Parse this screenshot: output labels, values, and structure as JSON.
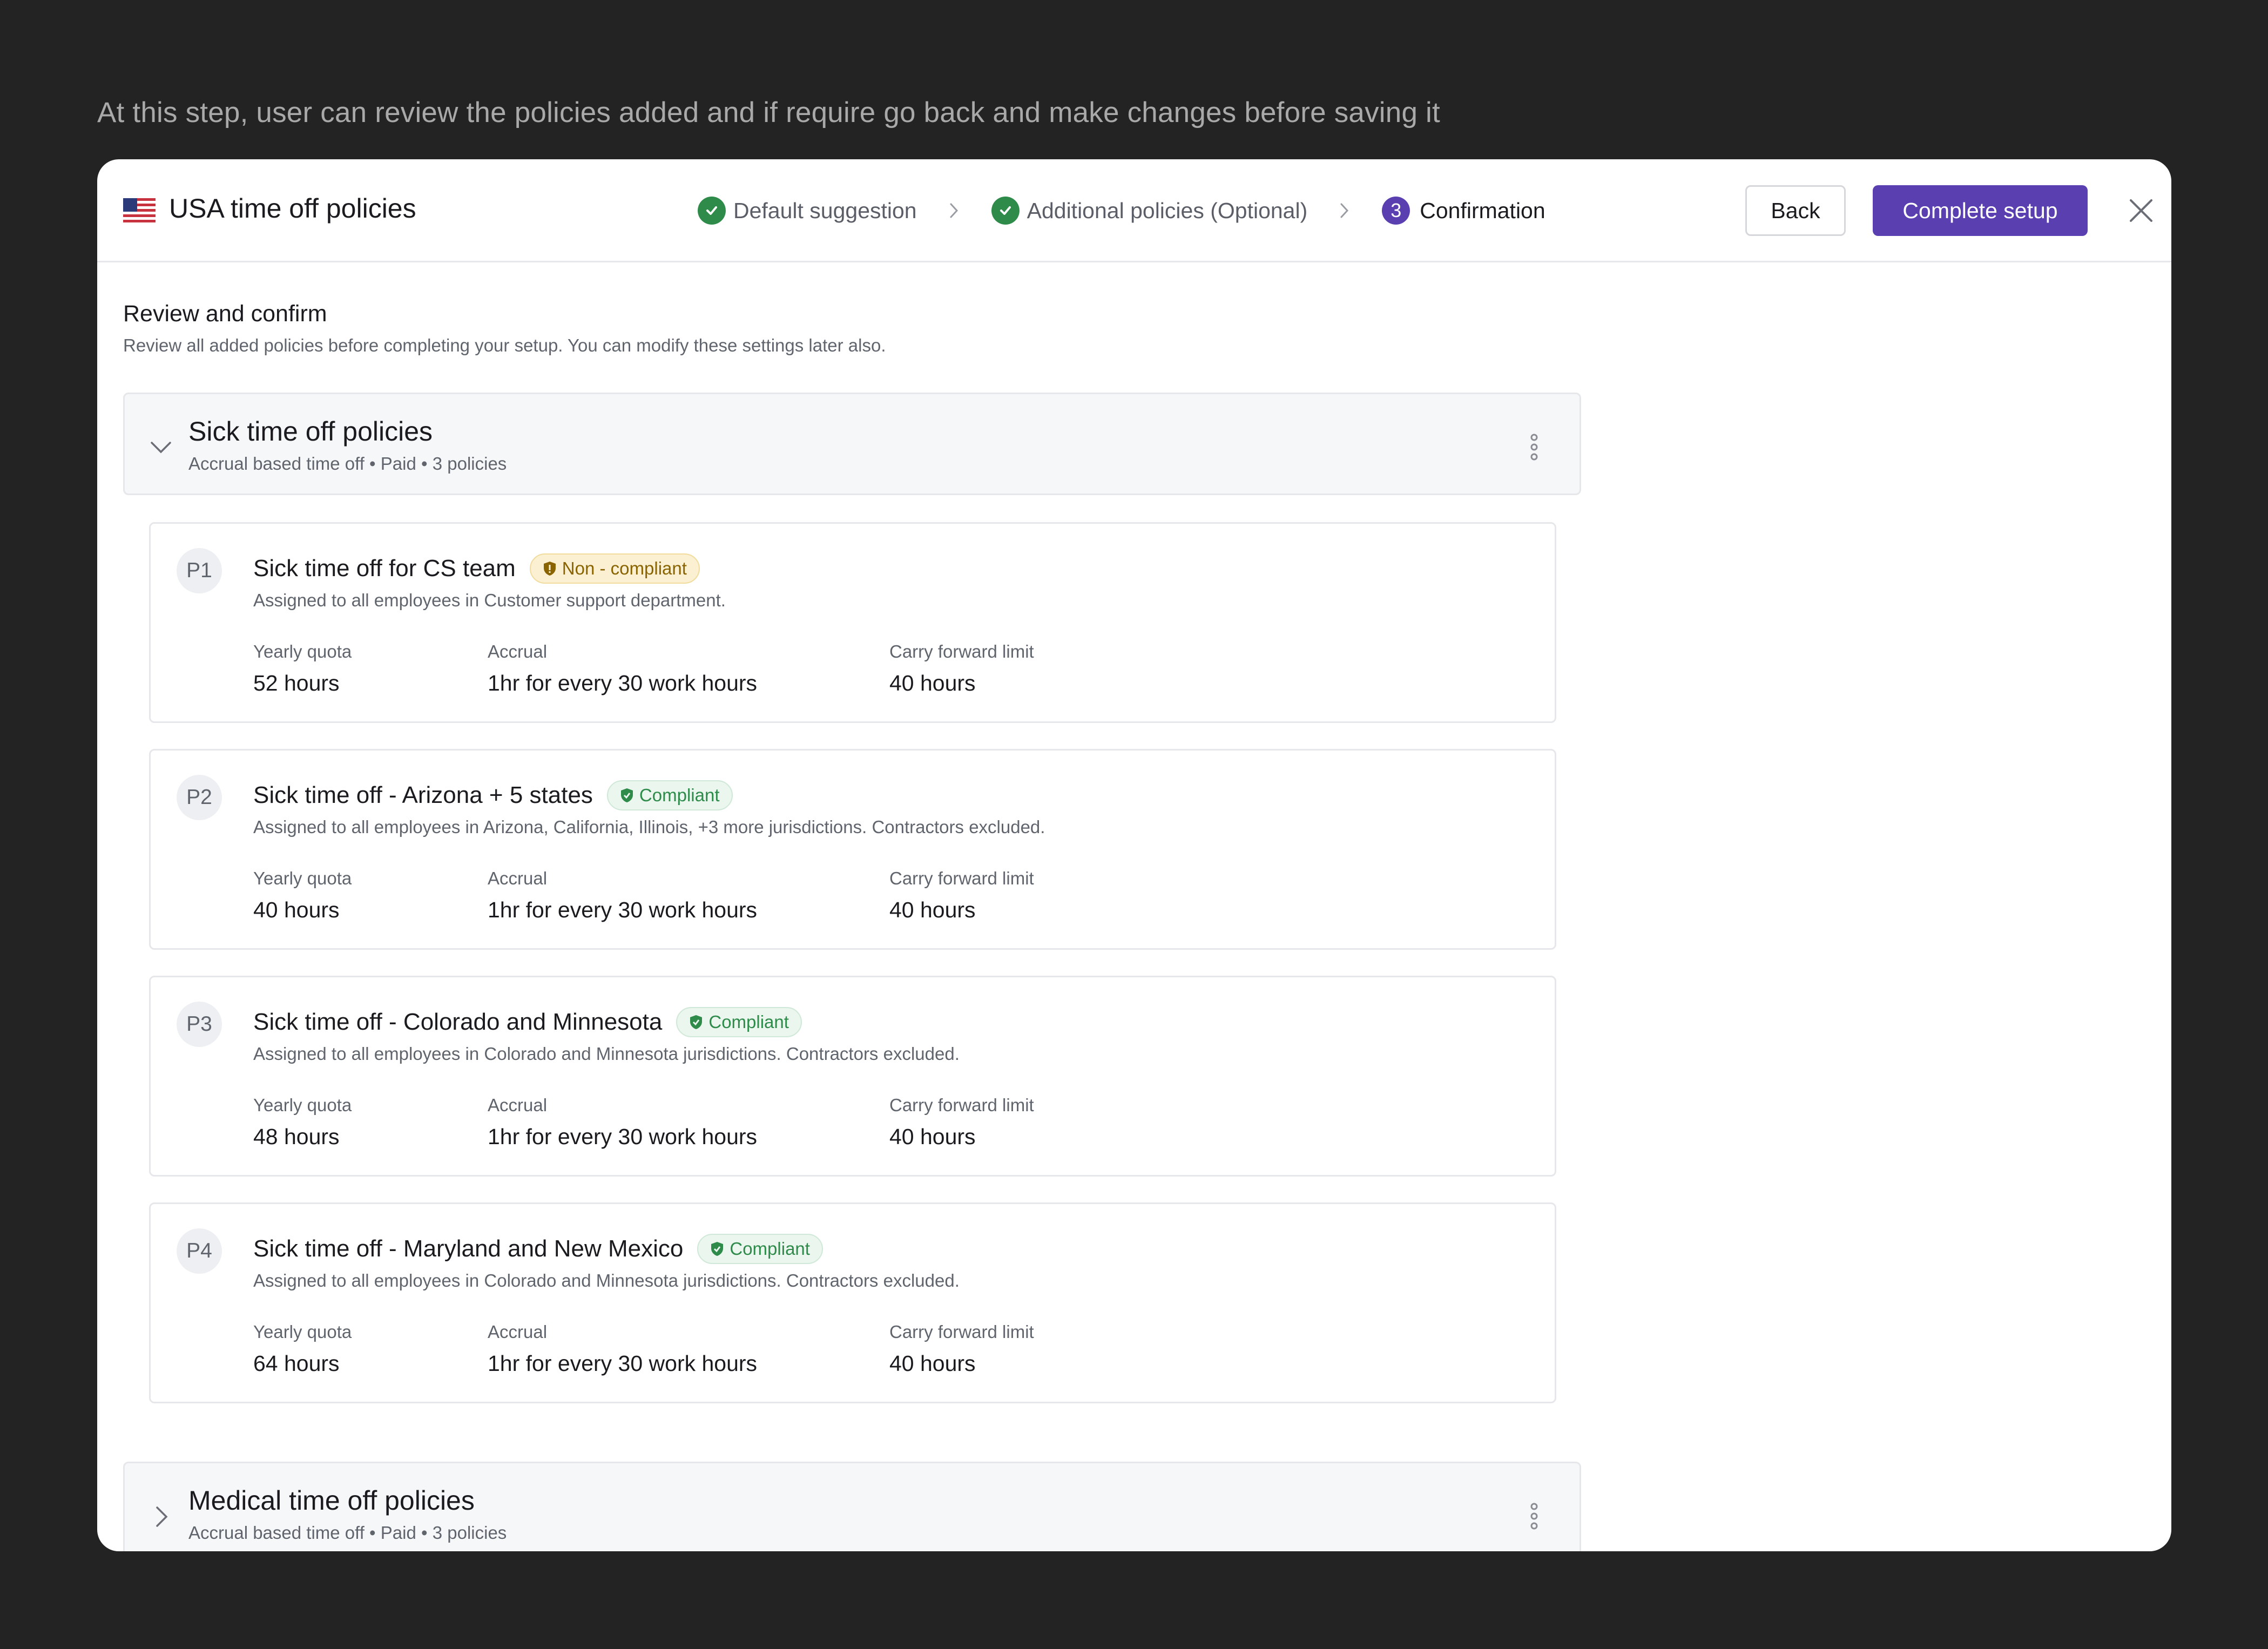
{
  "caption": "At this step, user can review the policies added and if require go back and make changes before saving it",
  "header": {
    "title": "USA time off policies",
    "flag_icon": "usa-flag-icon",
    "steps": [
      {
        "label": "Default suggestion",
        "state": "done"
      },
      {
        "label": "Additional policies (Optional)",
        "state": "done"
      },
      {
        "label": "Confirmation",
        "state": "active",
        "number": "3"
      }
    ],
    "back_label": "Back",
    "complete_label": "Complete setup",
    "accent_color": "#5a3fb0"
  },
  "review": {
    "title": "Review and confirm",
    "subtitle": "Review all added policies before completing your setup. You can modify these settings later also."
  },
  "groups": [
    {
      "title": "Sick time off policies",
      "subtitle": "Accrual based time off • Paid • 3 policies",
      "expanded": true,
      "policies": [
        {
          "badge": "P1",
          "title": "Sick time off for CS team",
          "status": "Non - compliant",
          "status_type": "warning",
          "description": "Assigned to all employees in Customer support department.",
          "fields": [
            {
              "label": "Yearly quota",
              "value": "52 hours"
            },
            {
              "label": "Accrual",
              "value": "1hr for every 30 work hours"
            },
            {
              "label": "Carry forward limit",
              "value": "40 hours"
            }
          ]
        },
        {
          "badge": "P2",
          "title": "Sick time off - Arizona + 5 states",
          "status": "Compliant",
          "status_type": "success",
          "description": "Assigned to all employees in Arizona, California, Illinois, +3 more jurisdictions. Contractors excluded.",
          "fields": [
            {
              "label": "Yearly quota",
              "value": "40 hours"
            },
            {
              "label": "Accrual",
              "value": "1hr for every 30 work hours"
            },
            {
              "label": "Carry forward limit",
              "value": "40 hours"
            }
          ]
        },
        {
          "badge": "P3",
          "title": "Sick time off - Colorado and Minnesota",
          "status": "Compliant",
          "status_type": "success",
          "description": "Assigned to all employees in Colorado and Minnesota jurisdictions. Contractors excluded.",
          "fields": [
            {
              "label": "Yearly quota",
              "value": "48 hours"
            },
            {
              "label": "Accrual",
              "value": "1hr for every 30 work hours"
            },
            {
              "label": "Carry forward limit",
              "value": "40 hours"
            }
          ]
        },
        {
          "badge": "P4",
          "title": "Sick time off - Maryland and New Mexico",
          "status": "Compliant",
          "status_type": "success",
          "description": "Assigned to all employees in Colorado and Minnesota jurisdictions. Contractors excluded.",
          "fields": [
            {
              "label": "Yearly quota",
              "value": "64 hours"
            },
            {
              "label": "Accrual",
              "value": "1hr for every 30 work hours"
            },
            {
              "label": "Carry forward limit",
              "value": "40 hours"
            }
          ]
        }
      ]
    },
    {
      "title": "Medical time off policies",
      "subtitle": "Accrual based time off • Paid • 3 policies",
      "expanded": false
    }
  ]
}
